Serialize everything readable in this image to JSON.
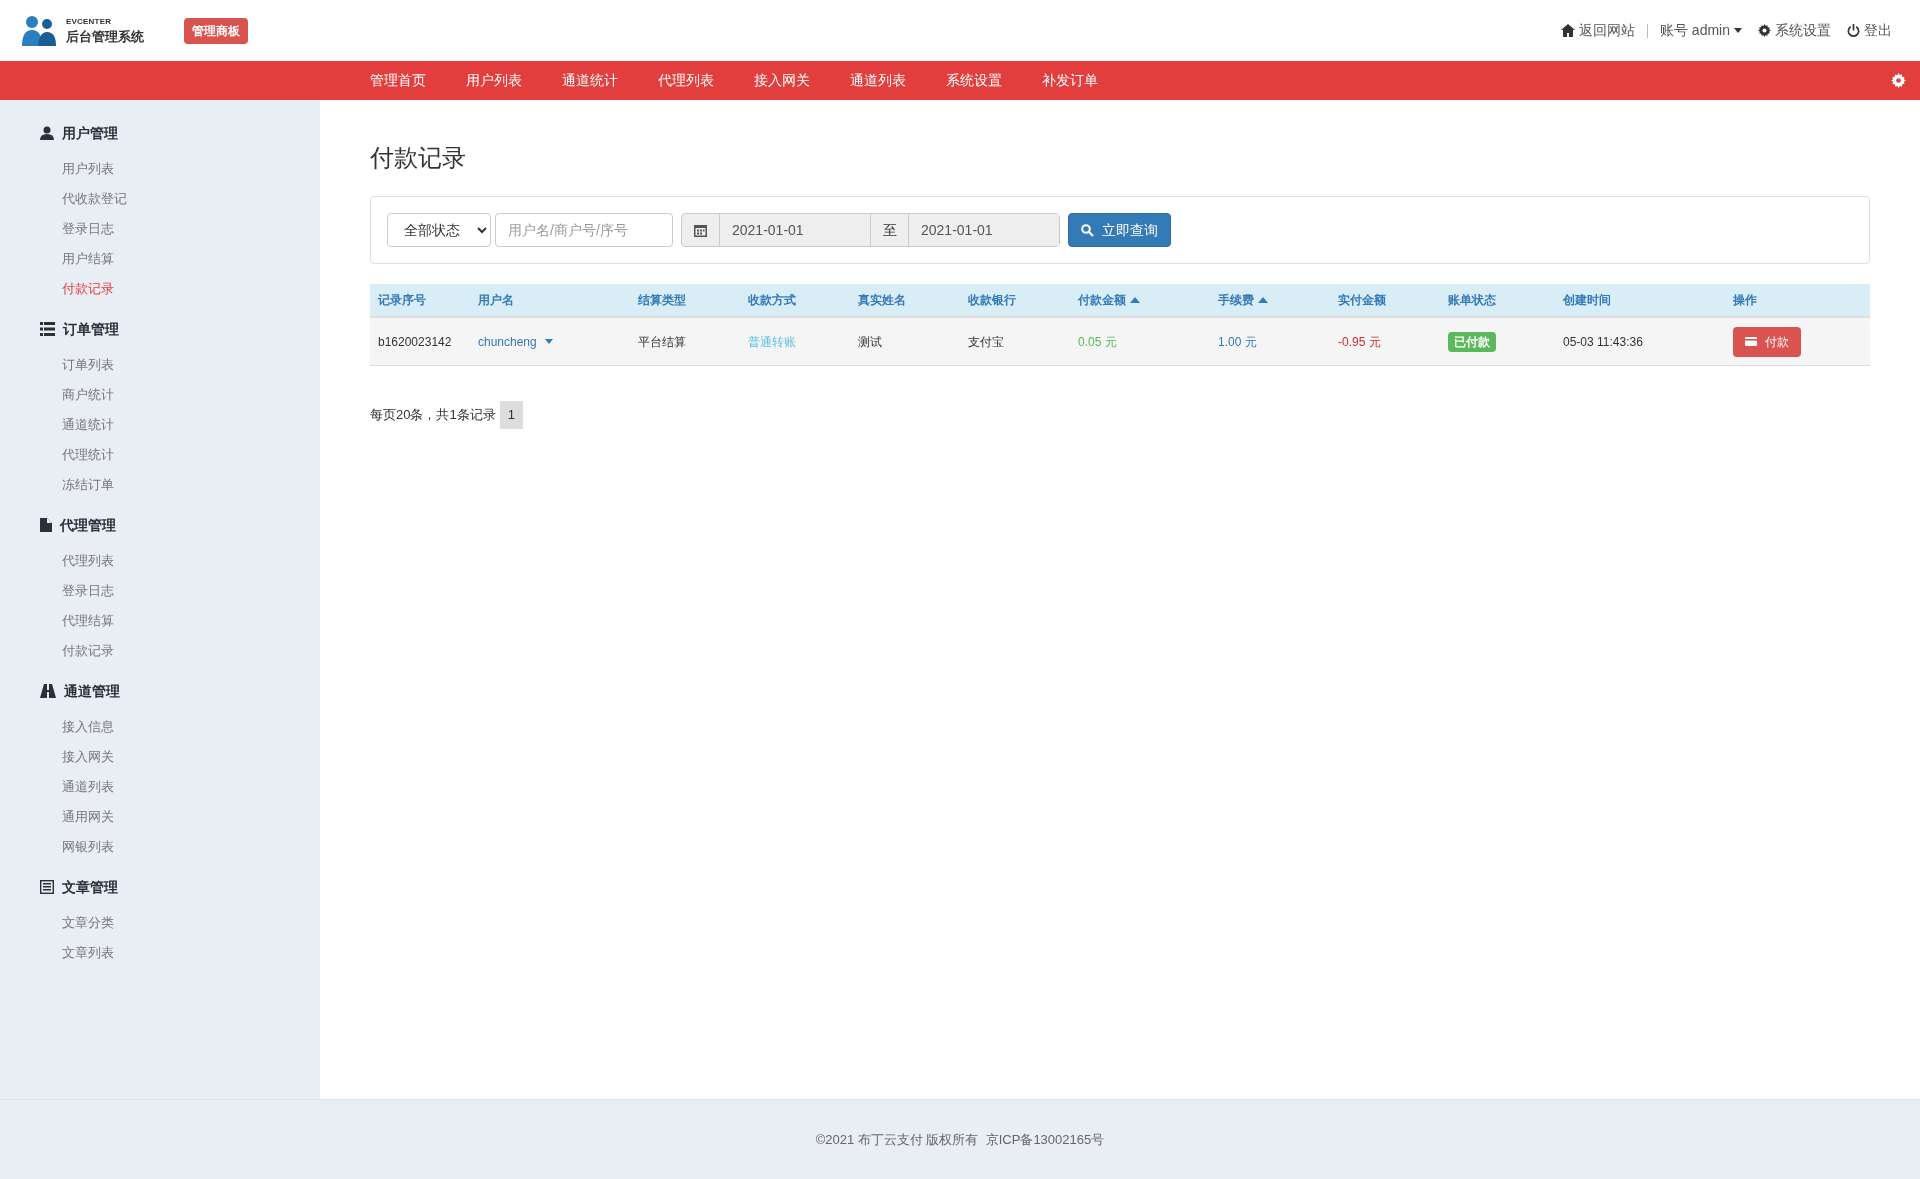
{
  "brand": {
    "tag": "EVCENTER",
    "title": "后台管理系统",
    "badge": "管理商板"
  },
  "top_links": [
    {
      "kind": "home",
      "label": "返回网站"
    },
    {
      "kind": "account",
      "label": "账号 admin"
    },
    {
      "kind": "settings",
      "label": "系统设置"
    },
    {
      "kind": "logout",
      "label": "登出"
    }
  ],
  "nav": [
    {
      "label": "管理首页"
    },
    {
      "label": "用户列表"
    },
    {
      "label": "通道统计"
    },
    {
      "label": "代理列表"
    },
    {
      "label": "接入网关"
    },
    {
      "label": "通道列表"
    },
    {
      "label": "系统设置"
    },
    {
      "label": "补发订单"
    }
  ],
  "sidebar": [
    {
      "kind": "user",
      "label": "用户管理",
      "children": [
        {
          "label": "用户列表",
          "selected": false
        },
        {
          "label": "代收款登记",
          "selected": false
        },
        {
          "label": "登录日志",
          "selected": false
        },
        {
          "label": "用户结算",
          "selected": false
        },
        {
          "label": "付款记录",
          "selected": true
        }
      ]
    },
    {
      "kind": "list",
      "label": "订单管理",
      "children": [
        {
          "label": "订单列表",
          "selected": false
        },
        {
          "label": "商户统计",
          "selected": false
        },
        {
          "label": "通道统计",
          "selected": false
        },
        {
          "label": "代理统计",
          "selected": false
        },
        {
          "label": "冻结订单",
          "selected": false
        }
      ]
    },
    {
      "kind": "file",
      "label": "代理管理",
      "children": [
        {
          "label": "代理列表",
          "selected": false
        },
        {
          "label": "登录日志",
          "selected": false
        },
        {
          "label": "代理结算",
          "selected": false
        },
        {
          "label": "付款记录",
          "selected": false
        }
      ]
    },
    {
      "kind": "road",
      "label": "通道管理",
      "children": [
        {
          "label": "接入信息",
          "selected": false
        },
        {
          "label": "接入网关",
          "selected": false
        },
        {
          "label": "通道列表",
          "selected": false
        },
        {
          "label": "通用网关",
          "selected": false
        },
        {
          "label": "网银列表",
          "selected": false
        }
      ]
    },
    {
      "kind": "doc",
      "label": "文章管理",
      "children": [
        {
          "label": "文章分类",
          "selected": false
        },
        {
          "label": "文章列表",
          "selected": false
        }
      ]
    }
  ],
  "page_title": "付款记录",
  "filter": {
    "status": "全部状态",
    "search_placeholder": "用户名/商户号/序号",
    "date_from": "2021-01-01",
    "to": "至",
    "date_to": "2021-01-01",
    "button": "立即查询"
  },
  "table": {
    "columns": [
      {
        "label": "记录序号",
        "sorted": false
      },
      {
        "label": "用户名",
        "sorted": false
      },
      {
        "label": "结算类型",
        "sorted": false
      },
      {
        "label": "收款方式",
        "sorted": false
      },
      {
        "label": "真实姓名",
        "sorted": false
      },
      {
        "label": "收款银行",
        "sorted": false
      },
      {
        "label": "付款金额",
        "sorted": true
      },
      {
        "label": "手续费",
        "sorted": true
      },
      {
        "label": "实付金额",
        "sorted": false
      },
      {
        "label": "账单状态",
        "sorted": false
      },
      {
        "label": "创建时间",
        "sorted": false
      },
      {
        "label": "操作",
        "sorted": false
      }
    ],
    "rows": [
      {
        "id": "b1620023142",
        "user": "chuncheng",
        "type": "平台结算",
        "method": "普通转账",
        "name": "测试",
        "bank": "支付宝",
        "amount": "0.05 元",
        "fee": "1.00 元",
        "paid": "-0.95 元",
        "status": "已付款",
        "time": "05-03 11:43:36",
        "action": "付款"
      }
    ]
  },
  "pagination": {
    "summary": "每页20条，共1条记录",
    "pages": [
      {
        "label": "1",
        "selected": true
      }
    ]
  },
  "footer": "©2021 布丁云支付 版权所有  京ICP备13002165号"
}
